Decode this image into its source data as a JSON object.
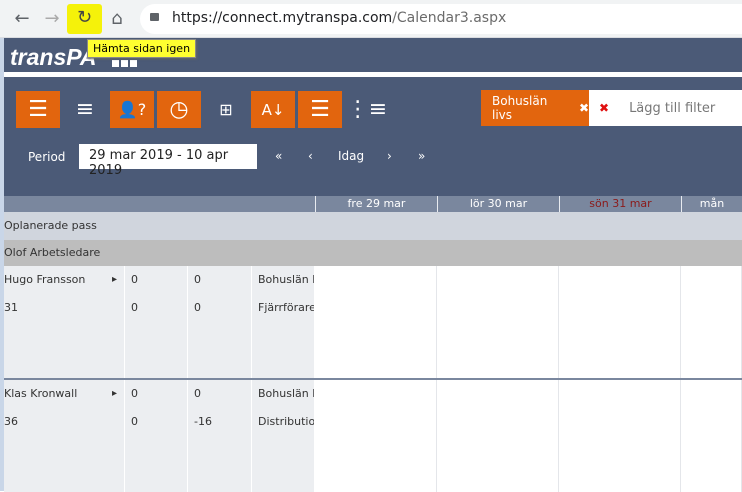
{
  "browser": {
    "url_host": "https://connect.mytranspa.com",
    "url_path": "/Calendar3.aspx",
    "tooltip": "Hämta sidan igen",
    "icons": [
      "back-icon",
      "forward-icon",
      "reload-icon",
      "home-icon",
      "lock-icon"
    ]
  },
  "app": {
    "logo": "transPA"
  },
  "toolbar": {
    "icons": [
      "menu-icon",
      "align-icon",
      "user-question-icon",
      "clock-icon",
      "grid-icon",
      "sort-az-icon",
      "rows-icon",
      "list-icon"
    ]
  },
  "filter": {
    "chip_label": "Bohuslän livs",
    "placeholder": "Lägg till filter"
  },
  "period": {
    "label": "Period",
    "value": "29 mar 2019 - 10 apr 2019",
    "first": "«",
    "prev": "‹",
    "today": "Idag",
    "next": "›",
    "last": "»"
  },
  "days": [
    {
      "label": "fre 29 mar",
      "color": "#ffffff"
    },
    {
      "label": "lör 30 mar",
      "color": "#ffffff"
    },
    {
      "label": "sön 31 mar",
      "color": "#8b1a1a"
    },
    {
      "label": "mån",
      "color": "#ffffff"
    }
  ],
  "unplanned": "Oplanerade pass",
  "group": "Olof Arbetsledare",
  "rows": [
    {
      "c0": "Hugo Fransson",
      "arrow": "▸",
      "c1": "0",
      "c2": "0",
      "c3": "Bohuslän li"
    },
    {
      "c0": "31",
      "arrow": "",
      "c1": "0",
      "c2": "0",
      "c3": "Fjärrförare"
    },
    {
      "c0": "",
      "arrow": "",
      "c1": "",
      "c2": "",
      "c3": ""
    },
    {
      "c0": "",
      "arrow": "",
      "c1": "",
      "c2": "",
      "c3": ""
    },
    {
      "c0": "Klas Kronwall",
      "arrow": "▸",
      "c1": "0",
      "c2": "0",
      "c3": "Bohuslän li"
    },
    {
      "c0": "36",
      "arrow": "",
      "c1": "0",
      "c2": "-16",
      "c3": "Distributio"
    },
    {
      "c0": "",
      "arrow": "",
      "c1": "",
      "c2": "",
      "c3": ""
    },
    {
      "c0": "",
      "arrow": "",
      "c1": "",
      "c2": "",
      "c3": ""
    }
  ],
  "colors": {
    "accent": "#e2650e",
    "header": "#4b5a77"
  }
}
